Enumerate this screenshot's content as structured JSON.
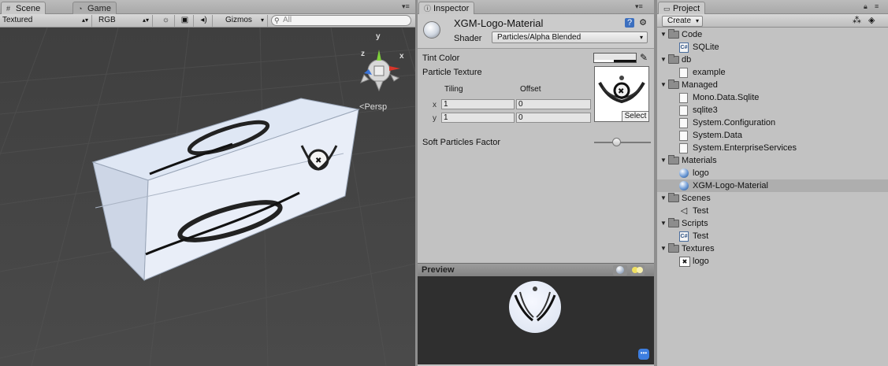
{
  "scene": {
    "tab_label": "Scene",
    "game_tab_label": "Game",
    "toolbar": {
      "render_mode": "Textured",
      "color_mode": "RGB",
      "gizmos_label": "Gizmos",
      "search_placeholder": "All"
    },
    "gizmo": {
      "x_label": "x",
      "y_label": "y",
      "z_label": "z",
      "view_label": "Persp"
    }
  },
  "inspector": {
    "tab_label": "Inspector",
    "material_name": "XGM-Logo-Material",
    "shader_label": "Shader",
    "shader_value": "Particles/Alpha Blended",
    "tint_color_label": "Tint Color",
    "particle_texture_label": "Particle Texture",
    "tiling_label": "Tiling",
    "offset_label": "Offset",
    "x_axis_label": "x",
    "y_axis_label": "y",
    "tiling_x": "1",
    "tiling_y": "1",
    "offset_x": "0",
    "offset_y": "0",
    "texture_select_label": "Select",
    "soft_particles_label": "Soft Particles Factor",
    "soft_particles_value": 0.4,
    "preview_title": "Preview"
  },
  "project": {
    "tab_label": "Project",
    "create_label": "Create",
    "items": [
      {
        "label": "Code",
        "kind": "folder",
        "depth": 0
      },
      {
        "label": "SQLite",
        "kind": "cs-file",
        "depth": 1
      },
      {
        "label": "db",
        "kind": "folder",
        "depth": 0
      },
      {
        "label": "example",
        "kind": "file",
        "depth": 1
      },
      {
        "label": "Managed",
        "kind": "folder",
        "depth": 0
      },
      {
        "label": "Mono.Data.Sqlite",
        "kind": "file",
        "depth": 1
      },
      {
        "label": "sqlite3",
        "kind": "file",
        "depth": 1
      },
      {
        "label": "System.Configuration",
        "kind": "file",
        "depth": 1
      },
      {
        "label": "System.Data",
        "kind": "file",
        "depth": 1
      },
      {
        "label": "System.EnterpriseServices",
        "kind": "file",
        "depth": 1
      },
      {
        "label": "Materials",
        "kind": "folder",
        "depth": 0
      },
      {
        "label": "logo",
        "kind": "material",
        "depth": 1
      },
      {
        "label": "XGM-Logo-Material",
        "kind": "material",
        "depth": 1,
        "selected": true
      },
      {
        "label": "Scenes",
        "kind": "folder",
        "depth": 0
      },
      {
        "label": "Test",
        "kind": "scene",
        "depth": 1
      },
      {
        "label": "Scripts",
        "kind": "folder",
        "depth": 0
      },
      {
        "label": "Test",
        "kind": "cs-file",
        "depth": 1
      },
      {
        "label": "Textures",
        "kind": "folder",
        "depth": 0
      },
      {
        "label": "logo",
        "kind": "texture",
        "depth": 1
      }
    ]
  },
  "colors": {
    "panel_bg": "#c2c2c2",
    "viewport_bg": "#464646",
    "selection": "#aeaeae",
    "gizmo_x": "#d8352a",
    "gizmo_y": "#7fd13b",
    "gizmo_z": "#3a74d8"
  }
}
